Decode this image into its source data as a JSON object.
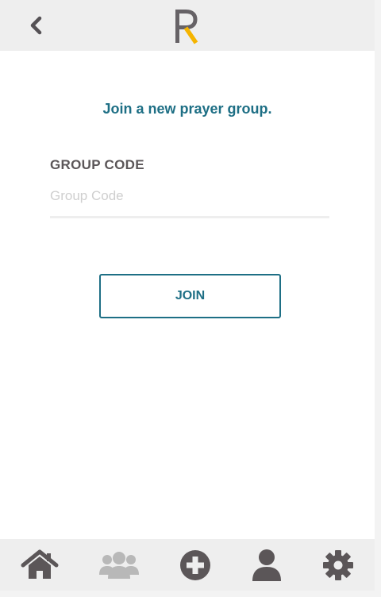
{
  "app": {
    "brand_color": "#1e6f85",
    "accent_color": "#f5b400",
    "icon_color": "#5b5658",
    "inactive_icon_color": "#b8b8b8"
  },
  "header": {
    "back_icon": "chevron-left-icon",
    "logo_letter": "R"
  },
  "main": {
    "title": "Join a new prayer group.",
    "field_label": "GROUP CODE",
    "group_code_placeholder": "Group Code",
    "group_code_value": "",
    "join_button_label": "JOIN"
  },
  "tabbar": {
    "tabs": [
      {
        "icon": "home-icon",
        "active": false
      },
      {
        "icon": "groups-icon",
        "active": true
      },
      {
        "icon": "add-circle-icon",
        "active": false
      },
      {
        "icon": "user-icon",
        "active": false
      },
      {
        "icon": "gear-icon",
        "active": false
      }
    ]
  }
}
